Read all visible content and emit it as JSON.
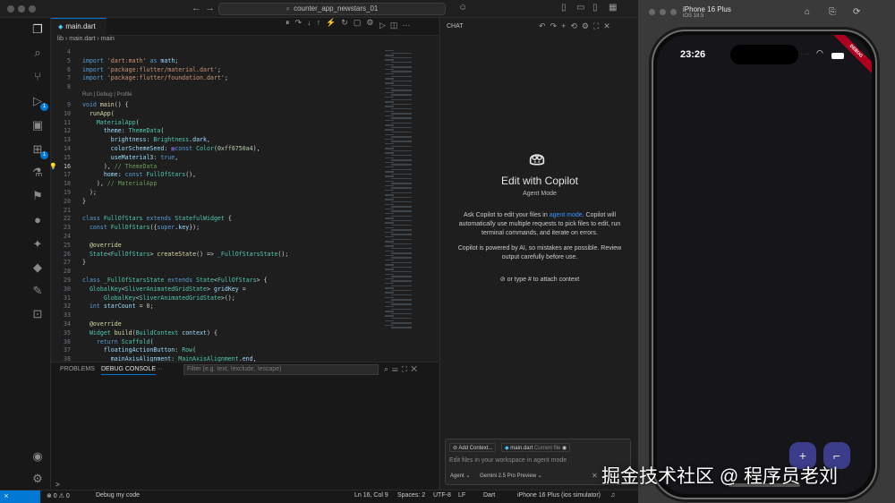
{
  "window": {
    "search_text": "counter_app_newstars_01"
  },
  "editor": {
    "tab_label": "main.dart",
    "breadcrumb": [
      "lib",
      "main.dart",
      "main"
    ],
    "codelens": "Run | Debug | Profile",
    "lines": [
      {
        "n": "4",
        "html": ""
      },
      {
        "n": "5",
        "html": "<span class='kw'>import</span> <span class='str'>'dart:math'</span> <span class='kw'>as</span> <span class='pr'>math</span>;"
      },
      {
        "n": "6",
        "html": "<span class='kw'>import</span> <span class='str'>'package:flutter/material.dart'</span>;"
      },
      {
        "n": "7",
        "html": "<span class='kw'>import</span> <span class='str'>'package:flutter/foundation.dart'</span>;"
      },
      {
        "n": "8",
        "html": ""
      },
      {
        "n": "9",
        "html": "<span class='kw'>void</span> <span class='fn'>main</span>() {"
      },
      {
        "n": "10",
        "html": "  <span class='fn'>runApp</span>("
      },
      {
        "n": "11",
        "html": "    <span class='ty'>MaterialApp</span>("
      },
      {
        "n": "12",
        "html": "      <span class='pr'>theme</span>: <span class='ty'>ThemeData</span>("
      },
      {
        "n": "13",
        "html": "        <span class='pr'>brightness</span>: <span class='ty'>Brightness</span>.<span class='pr'>dark</span>,"
      },
      {
        "n": "14",
        "html": "        <span class='pr'>colorSchemeSeed</span>: <span style='color:#6750a4'>&#9632;</span><span class='kw'>const</span> <span class='ty'>Color</span>(<span class='num'>0xff6750a4</span>),"
      },
      {
        "n": "15",
        "html": "        <span class='pr'>useMaterial3</span>: <span class='kw'>true</span>,"
      },
      {
        "n": "16",
        "html": "      ), <span class='cm'>// ThemeData</span>",
        "current": true
      },
      {
        "n": "17",
        "html": "      <span class='pr'>home</span>: <span class='kw'>const</span> <span class='ty'>FullOfStars</span>(),"
      },
      {
        "n": "18",
        "html": "    ), <span class='cm'>// MaterialApp</span>"
      },
      {
        "n": "19",
        "html": "  );"
      },
      {
        "n": "20",
        "html": "}"
      },
      {
        "n": "21",
        "html": ""
      },
      {
        "n": "22",
        "html": "<span class='kw'>class</span> <span class='ty'>FullOfStars</span> <span class='kw'>extends</span> <span class='ty'>StatefulWidget</span> {"
      },
      {
        "n": "23",
        "html": "  <span class='kw'>const</span> <span class='ty'>FullOfStars</span>({<span class='kw'>super</span>.<span class='pr'>key</span>});"
      },
      {
        "n": "24",
        "html": ""
      },
      {
        "n": "25",
        "html": "  <span class='cm' style='color:#dcdcaa'>@override</span>"
      },
      {
        "n": "26",
        "html": "  <span class='ty'>State</span>&lt;<span class='ty'>FullOfStars</span>&gt; <span class='fn'>createState</span>() =&gt; <span class='ty'>_FullOfStarsState</span>();"
      },
      {
        "n": "27",
        "html": "}"
      },
      {
        "n": "28",
        "html": ""
      },
      {
        "n": "29",
        "html": "<span class='kw'>class</span> <span class='ty'>_FullOfStarsState</span> <span class='kw'>extends</span> <span class='ty'>State</span>&lt;<span class='ty'>FullOfStars</span>&gt; {"
      },
      {
        "n": "30",
        "html": "  <span class='ty'>GlobalKey</span>&lt;<span class='ty'>SliverAnimatedGridState</span>&gt; <span class='pr'>gridKey</span> ="
      },
      {
        "n": "31",
        "html": "      <span class='ty'>GlobalKey</span>&lt;<span class='ty'>SliverAnimatedGridState</span>&gt;();"
      },
      {
        "n": "32",
        "html": "  <span class='kw'>int</span> <span class='pr'>starCount</span> = <span class='num'>0</span>;"
      },
      {
        "n": "33",
        "html": ""
      },
      {
        "n": "34",
        "html": "  <span class='cm' style='color:#dcdcaa'>@override</span>"
      },
      {
        "n": "35",
        "html": "  <span class='ty'>Widget</span> <span class='fn'>build</span>(<span class='ty'>BuildContext</span> <span class='pr'>context</span>) {"
      },
      {
        "n": "36",
        "html": "    <span class='kw'>return</span> <span class='ty'>Scaffold</span>("
      },
      {
        "n": "37",
        "html": "      <span class='pr'>floatingActionButton</span>: <span class='ty'>Row</span>("
      },
      {
        "n": "38",
        "html": "        <span class='pr'>mainAxisAlignment</span>: <span class='ty'>MainAxisAlignment</span>.<span class='pr'>end</span>,"
      }
    ]
  },
  "panel": {
    "tabs": [
      "PROBLEMS",
      "DEBUG CONSOLE"
    ],
    "more": "···",
    "filter_placeholder": "Filter (e.g. text, !exclude, \\escape)",
    "prompt": ">"
  },
  "chat": {
    "title": "CHAT",
    "heading": "Edit with Copilot",
    "mode": "Agent Mode",
    "p1_before": "Ask Copilot to edit your files in ",
    "p1_link": "agent mode",
    "p1_after": ". Copilot will automatically use multiple requests to pick files to edit, run terminal commands, and iterate on errors.",
    "p2": "Copilot is powered by AI, so mistakes are possible. Review output carefully before use.",
    "attach": "or type # to attach context",
    "input": {
      "add_context": "Add Context...",
      "file_chip": "main.dart",
      "file_chip_note": "Current file",
      "placeholder": "Edit files in your workspace in agent mode",
      "agent_label": "Agent",
      "model_label": "Gemini 2.5 Pro Preview"
    }
  },
  "status": {
    "remote": "⨯",
    "problems": "⊗ 0 ⚠ 0",
    "debug": "Debug my code",
    "position": "Ln 16, Col 9",
    "spaces": "Spaces: 2",
    "encoding": "UTF-8",
    "eol": "LF",
    "language": "Dart",
    "device": "iPhone 16 Plus (ios simulator)"
  },
  "simulator": {
    "device_name": "iPhone 16 Plus",
    "os": "iOS 18.5",
    "time": "23:26",
    "debug_banner": "DEBUG",
    "fab_add": "+",
    "fab_remove": "⌐"
  },
  "watermark": "掘金技术社区 @ 程序员老刘"
}
